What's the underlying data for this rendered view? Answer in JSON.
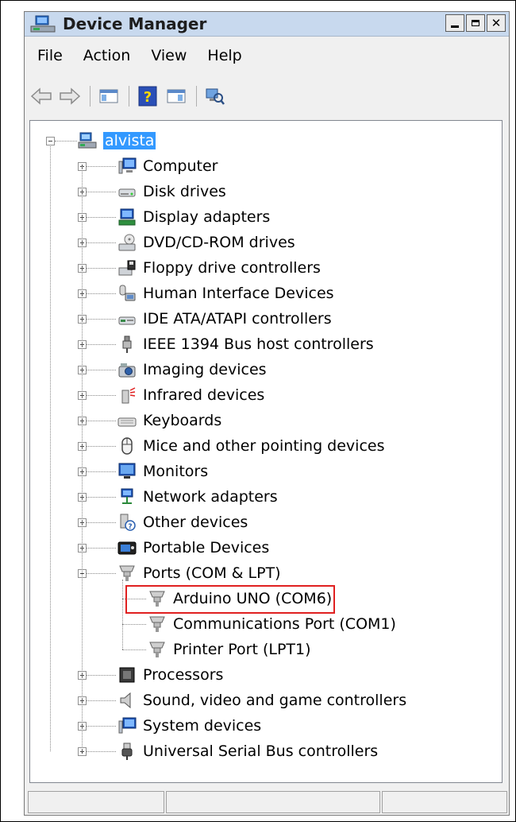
{
  "window": {
    "title": "Device Manager"
  },
  "menu": [
    {
      "id": "file",
      "label": "File"
    },
    {
      "id": "action",
      "label": "Action"
    },
    {
      "id": "view",
      "label": "View"
    },
    {
      "id": "help",
      "label": "Help"
    }
  ],
  "toolbar": {
    "icons": [
      "back-arrow-icon",
      "forward-arrow-icon",
      "show-hide-console-tree-icon",
      "help-icon",
      "properties-pane-icon",
      "scan-hardware-icon"
    ]
  },
  "tree": {
    "root": {
      "label": "alvista",
      "icon": "computer-network-icon"
    },
    "categories": [
      {
        "label": "Computer",
        "icon": "computer-icon",
        "expanded": false
      },
      {
        "label": "Disk drives",
        "icon": "disk-drive-icon",
        "expanded": false
      },
      {
        "label": "Display adapters",
        "icon": "display-adapter-icon",
        "expanded": false
      },
      {
        "label": "DVD/CD-ROM drives",
        "icon": "dvd-drive-icon",
        "expanded": false
      },
      {
        "label": "Floppy drive controllers",
        "icon": "floppy-controller-icon",
        "expanded": false
      },
      {
        "label": "Human Interface Devices",
        "icon": "hid-icon",
        "expanded": false
      },
      {
        "label": "IDE ATA/ATAPI controllers",
        "icon": "ide-controller-icon",
        "expanded": false
      },
      {
        "label": "IEEE 1394 Bus host controllers",
        "icon": "ieee1394-icon",
        "expanded": false
      },
      {
        "label": "Imaging devices",
        "icon": "camera-icon",
        "expanded": false
      },
      {
        "label": "Infrared devices",
        "icon": "infrared-icon",
        "expanded": false
      },
      {
        "label": "Keyboards",
        "icon": "keyboard-icon",
        "expanded": false
      },
      {
        "label": "Mice and other pointing devices",
        "icon": "mouse-icon",
        "expanded": false
      },
      {
        "label": "Monitors",
        "icon": "monitor-icon",
        "expanded": false
      },
      {
        "label": "Network adapters",
        "icon": "network-adapter-icon",
        "expanded": false
      },
      {
        "label": "Other devices",
        "icon": "unknown-device-icon",
        "expanded": false
      },
      {
        "label": "Portable Devices",
        "icon": "portable-device-icon",
        "expanded": false
      },
      {
        "label": "Ports (COM & LPT)",
        "icon": "port-connector-icon",
        "expanded": true,
        "children": [
          {
            "label": "Arduino UNO (COM6)",
            "icon": "port-connector-icon",
            "highlighted": true
          },
          {
            "label": "Communications Port (COM1)",
            "icon": "port-connector-icon"
          },
          {
            "label": "Printer Port (LPT1)",
            "icon": "port-connector-icon"
          }
        ]
      },
      {
        "label": "Processors",
        "icon": "processor-icon",
        "expanded": false
      },
      {
        "label": "Sound, video and game controllers",
        "icon": "speaker-icon",
        "expanded": false
      },
      {
        "label": "System devices",
        "icon": "system-device-icon",
        "expanded": false
      },
      {
        "label": "Universal Serial Bus controllers",
        "icon": "usb-icon",
        "expanded": false
      }
    ]
  },
  "colors": {
    "selection": "#3399ff",
    "highlight_box": "#e02020",
    "title_bar": "#c8d9ee"
  }
}
